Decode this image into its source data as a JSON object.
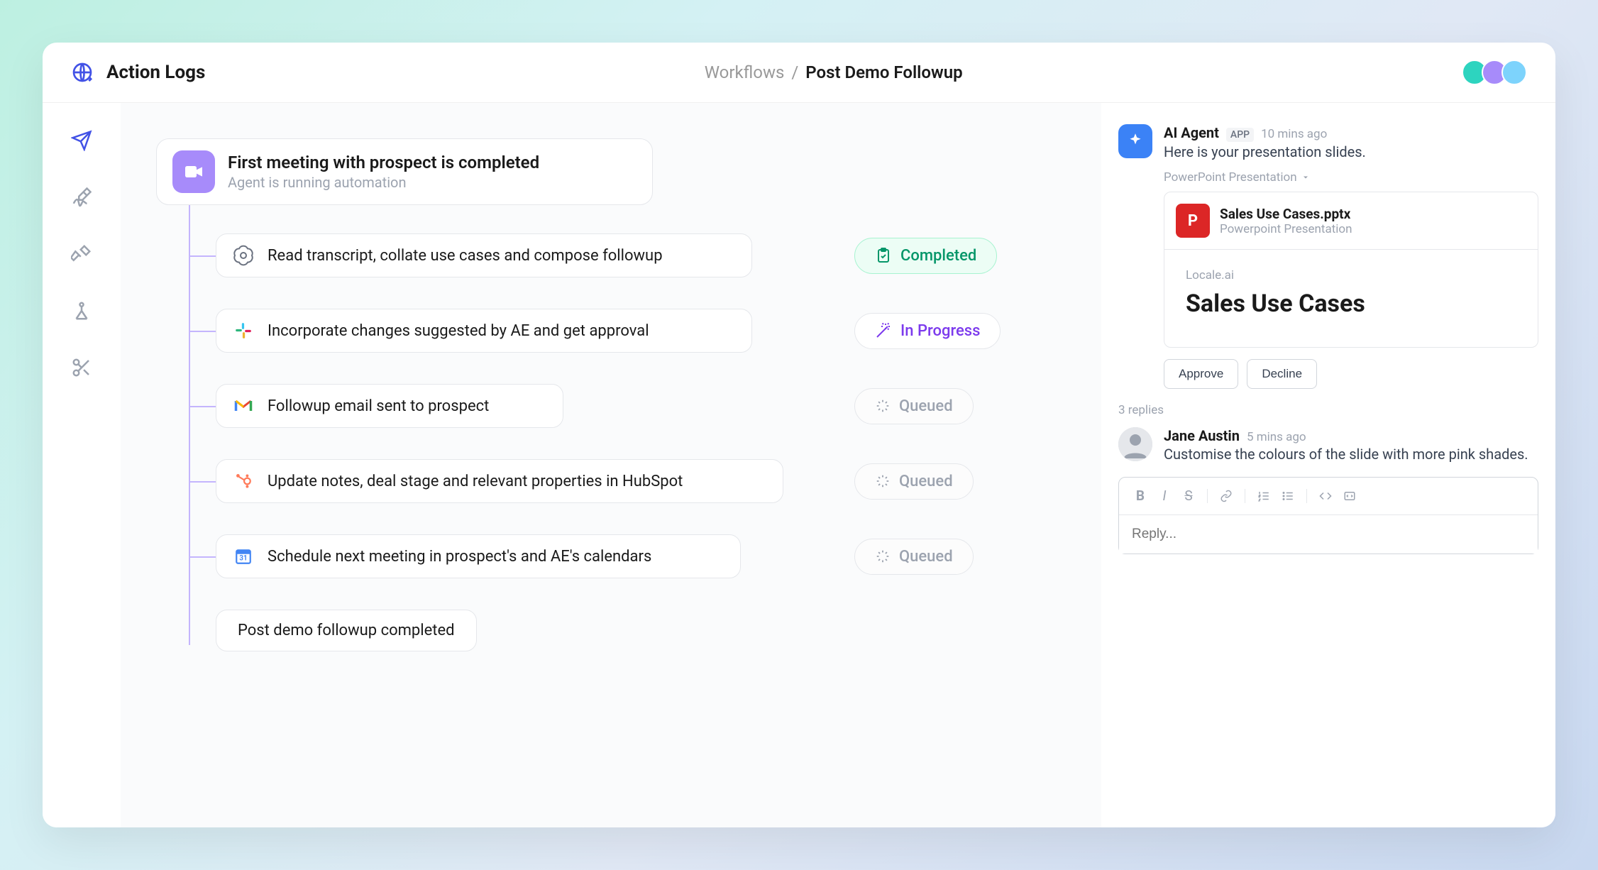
{
  "header": {
    "title": "Action Logs",
    "breadcrumb_parent": "Workflows",
    "breadcrumb_separator": "/",
    "breadcrumb_current": "Post Demo Followup"
  },
  "root": {
    "title": "First meeting with prospect is completed",
    "subtitle": "Agent is running automation"
  },
  "steps": [
    {
      "icon": "openai",
      "label": "Read transcript, collate use cases and compose followup",
      "status": "Completed",
      "status_kind": "completed"
    },
    {
      "icon": "slack",
      "label": "Incorporate changes suggested by AE and get approval",
      "status": "In Progress",
      "status_kind": "progress"
    },
    {
      "icon": "gmail",
      "label": "Followup email sent to prospect",
      "status": "Queued",
      "status_kind": "queued"
    },
    {
      "icon": "hubspot",
      "label": "Update notes, deal stage and relevant properties in HubSpot",
      "status": "Queued",
      "status_kind": "queued"
    },
    {
      "icon": "gcal",
      "label": "Schedule next meeting in prospect's and AE's calendars",
      "status": "Queued",
      "status_kind": "queued"
    }
  ],
  "final": {
    "label": "Post demo followup completed"
  },
  "chat": {
    "agent": {
      "name": "AI Agent",
      "badge": "APP",
      "time": "10 mins ago",
      "text": "Here is your presentation slides.",
      "attachment_label": "PowerPoint Presentation",
      "file_letter": "P",
      "file_name": "Sales Use Cases.pptx",
      "file_type": "Powerpoint Presentation",
      "preview_sub": "Locale.ai",
      "preview_title": "Sales Use Cases",
      "approve": "Approve",
      "decline": "Decline"
    },
    "replies_count": "3 replies",
    "user": {
      "name": "Jane Austin",
      "time": "5 mins ago",
      "text": "Customise the colours of the slide with more pink shades."
    },
    "reply_placeholder": "Reply..."
  }
}
